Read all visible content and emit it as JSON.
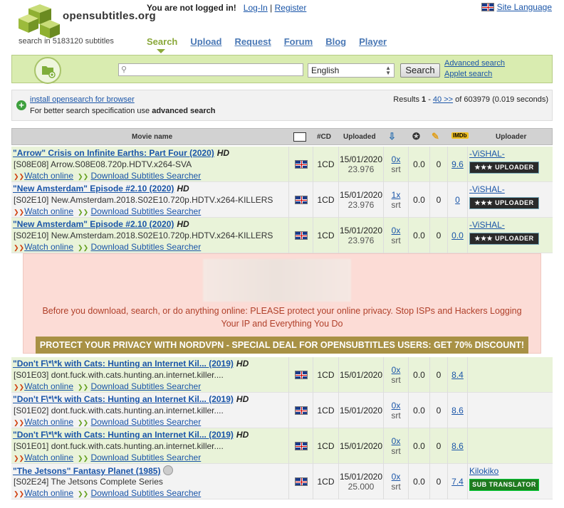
{
  "header": {
    "logo_text": "opensubtitles.org",
    "subtitle_count": "search in 5183120 subtitles",
    "not_logged": "You are not logged in!",
    "login_label": "Log-In",
    "separator": "|",
    "register_label": "Register",
    "site_language_label": "Site Language"
  },
  "nav": {
    "items": [
      "Search",
      "Upload",
      "Request",
      "Forum",
      "Blog",
      "Player"
    ],
    "active": "Search"
  },
  "search": {
    "input_value": "",
    "language": "English",
    "button_label": "Search",
    "advanced_link": "Advanced search",
    "applet_link": "Applet search"
  },
  "info": {
    "opensearch_link": "install opensearch for browser",
    "hint_prefix": "For better search specification use ",
    "hint_bold": "advanced search",
    "results_prefix": "Results ",
    "results_range_start": "1",
    "results_dash": " - ",
    "results_next": "40 >>",
    "results_suffix": " of 603979 (0.019 seconds)"
  },
  "table": {
    "headers": {
      "movie": "Movie name",
      "cd": "#CD",
      "uploaded": "Uploaded",
      "uploader": "Uploader"
    },
    "watch_label": "Watch online",
    "download_label": "Download Subtitles Searcher",
    "rows": [
      {
        "title": "\"Arrow\" Crisis on Infinite Earths: Part Four (2020)",
        "hd": "HD",
        "release": "[S08E08] Arrow.S08E08.720p.HDTV.x264-SVA",
        "cd": "1CD",
        "date": "15/01/2020",
        "fps": "23.976",
        "dl": "0x",
        "fmt": "srt",
        "rating": "0.0",
        "comments": "0",
        "imdb": "9.6",
        "uploader": "-ViSHAL-",
        "badge": "★★★ UPLOADER"
      },
      {
        "title": "\"New Amsterdam\" Episode #2.10 (2020)",
        "hd": "HD",
        "release": "[S02E10] New.Amsterdam.2018.S02E10.720p.HDTV.x264-KILLERS",
        "cd": "1CD",
        "date": "15/01/2020",
        "fps": "23.976",
        "dl": "1x",
        "fmt": "srt",
        "rating": "0.0",
        "comments": "0",
        "imdb": "0",
        "uploader": "-ViSHAL-",
        "badge": "★★★ UPLOADER"
      },
      {
        "title": "\"New Amsterdam\" Episode #2.10 (2020)",
        "hd": "HD",
        "release": "[S02E10] New.Amsterdam.2018.S02E10.720p.HDTV.x264-KILLERS",
        "cd": "1CD",
        "date": "15/01/2020",
        "fps": "23.976",
        "dl": "0x",
        "fmt": "srt",
        "rating": "0.0",
        "comments": "0",
        "imdb": "0.0",
        "uploader": "-ViSHAL-",
        "badge": "★★★ UPLOADER"
      },
      {
        "title": "\"Don't F\\*\\*k with Cats: Hunting an Internet Kil... (2019)",
        "hd": "HD",
        "release": "[S01E03] dont.fuck.with.cats.hunting.an.internet.killer....",
        "cd": "1CD",
        "date": "15/01/2020",
        "fps": "",
        "dl": "0x",
        "fmt": "srt",
        "rating": "0.0",
        "comments": "0",
        "imdb": "8.4",
        "uploader": "",
        "badge": ""
      },
      {
        "title": "\"Don't F\\*\\*k with Cats: Hunting an Internet Kil... (2019)",
        "hd": "HD",
        "release": "[S01E02] dont.fuck.with.cats.hunting.an.internet.killer....",
        "cd": "1CD",
        "date": "15/01/2020",
        "fps": "",
        "dl": "0x",
        "fmt": "srt",
        "rating": "0.0",
        "comments": "0",
        "imdb": "8.6",
        "uploader": "",
        "badge": ""
      },
      {
        "title": "\"Don't F\\*\\*k with Cats: Hunting an Internet Kil... (2019)",
        "hd": "HD",
        "release": "[S01E01] dont.fuck.with.cats.hunting.an.internet.killer....",
        "cd": "1CD",
        "date": "15/01/2020",
        "fps": "",
        "dl": "0x",
        "fmt": "srt",
        "rating": "0.0",
        "comments": "0",
        "imdb": "8.6",
        "uploader": "",
        "badge": ""
      },
      {
        "title": "\"The Jetsons\" Fantasy Planet (1985)",
        "hd": "",
        "release": "[S02E24] The Jetsons Complete Series",
        "cd": "1CD",
        "date": "15/01/2020",
        "fps": "25.000",
        "dl": "0x",
        "fmt": "srt",
        "rating": "0.0",
        "comments": "0",
        "imdb": "7.4",
        "uploader": "Kilokiko",
        "badge": "SUB TRANSLATOR"
      }
    ]
  },
  "ad": {
    "message": "Before you download, search, or do anything online: PLEASE protect your online privacy. Stop ISPs and Hackers Logging Your IP and Everything You Do",
    "cta": "PROTECT YOUR PRIVACY WITH NORDVPN - SPECIAL DEAL FOR OPENSUBTITLES USERS: GET 70% DISCOUNT!"
  }
}
